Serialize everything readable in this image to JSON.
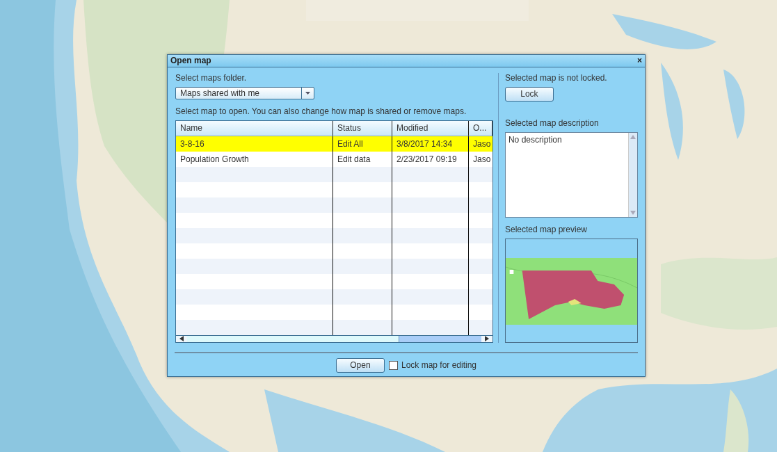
{
  "window": {
    "title": "Open map",
    "close": "×"
  },
  "folder": {
    "label": "Select maps folder.",
    "value": "Maps shared with me"
  },
  "instruction": "Select map to open. You can also change how map is shared or remove maps.",
  "table": {
    "columns": [
      "Name",
      "Status",
      "Modified",
      "O..."
    ],
    "rows": [
      {
        "cells": [
          "3-8-16",
          "Edit All",
          "3/8/2017 14:34",
          "Jaso"
        ],
        "selected": true
      },
      {
        "cells": [
          "Population Growth",
          "Edit data",
          "2/23/2017 09:19",
          "Jaso"
        ],
        "selected": false
      }
    ]
  },
  "lock": {
    "status": "Selected map is not locked.",
    "button": "Lock"
  },
  "description": {
    "label": "Selected map description",
    "text": "No description"
  },
  "preview": {
    "label": "Selected map preview",
    "kind": "picture"
  },
  "footer": {
    "open_button": "Open",
    "lock_checkbox": {
      "label": "Lock map for editing",
      "checked": false
    }
  }
}
